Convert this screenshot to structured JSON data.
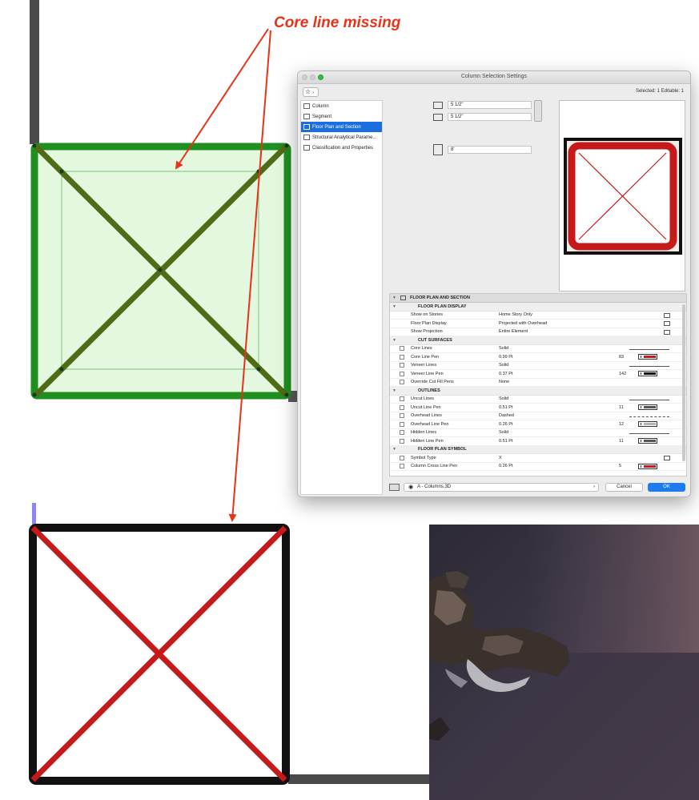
{
  "annotation": {
    "text": "Core line missing"
  },
  "dialog": {
    "title": "Column Selection Settings",
    "selected_info": "Selected: 1 Editable: 1",
    "favorites_label": "☆",
    "side_items": [
      {
        "label": "Column",
        "active": false
      },
      {
        "label": "Segment",
        "active": false
      },
      {
        "label": "Floor Plan and Section",
        "active": true
      },
      {
        "label": "Structural Analytical Parame...",
        "active": false
      },
      {
        "label": "Classification and Properties",
        "active": false
      }
    ],
    "width_value": "5 1/2\"",
    "depth_value": "5 1/2\"",
    "height_value": "8'",
    "panel_title": "FLOOR PLAN AND SECTION",
    "groups": [
      {
        "label": "FLOOR PLAN DISPLAY",
        "rows": [
          {
            "name": "Show on Stories",
            "value": "Home Story Only",
            "num": "",
            "swatch": "",
            "line": "",
            "icon": "stories-icon"
          },
          {
            "name": "Floor Plan Display",
            "value": "Projected with Overhead",
            "num": "",
            "swatch": "",
            "line": "",
            "icon": "display-icon"
          },
          {
            "name": "Show Projection",
            "value": "Entire Element",
            "num": "",
            "swatch": "",
            "line": "",
            "icon": "projection-icon"
          }
        ]
      },
      {
        "label": "CUT SURFACES",
        "rows": [
          {
            "name": "Core Lines",
            "value": "Solid",
            "num": "",
            "swatch": "",
            "line": "solid"
          },
          {
            "name": "Core Line Pen",
            "value": "0.99 Pt",
            "num": "83",
            "swatch": "#c51a1a",
            "line": ""
          },
          {
            "name": "Veneer Lines",
            "value": "Solid",
            "num": "",
            "swatch": "",
            "line": "solid"
          },
          {
            "name": "Veneer Line Pen",
            "value": "0.37 Pt",
            "num": "142",
            "swatch": "#111111",
            "line": ""
          },
          {
            "name": "Override Cut Fill Pens",
            "value": "None",
            "num": "",
            "swatch": "",
            "line": ""
          }
        ]
      },
      {
        "label": "OUTLINES",
        "rows": [
          {
            "name": "Uncut Lines",
            "value": "Solid",
            "num": "",
            "swatch": "",
            "line": "solid"
          },
          {
            "name": "Uncut Line Pen",
            "value": "0.51 Pt",
            "num": "11",
            "swatch": "#555555",
            "line": ""
          },
          {
            "name": "Overhead Lines",
            "value": "Dashed",
            "num": "",
            "swatch": "",
            "line": "dashed"
          },
          {
            "name": "Overhead Line Pen",
            "value": "0.26 Pt",
            "num": "12",
            "swatch": "#9a9a9a",
            "line": ""
          },
          {
            "name": "Hidden Lines",
            "value": "Solid",
            "num": "",
            "swatch": "",
            "line": "solid"
          },
          {
            "name": "Hidden Line Pen",
            "value": "0.51 Pt",
            "num": "11",
            "swatch": "#555555",
            "line": ""
          }
        ]
      },
      {
        "label": "FLOOR PLAN SYMBOL",
        "rows": [
          {
            "name": "Symbol Type",
            "value": "X",
            "num": "",
            "swatch": "",
            "line": "",
            "icon": "symbol-icon"
          },
          {
            "name": "Column Cross Line Pen",
            "value": "0.26 Pt",
            "num": "5",
            "swatch": "#c51a1a",
            "line": ""
          }
        ]
      }
    ],
    "layer_value": "A - Columns.3D",
    "cancel_label": "Cancel",
    "ok_label": "OK"
  },
  "colors": {
    "annotation_red": "#e8321a",
    "column_green": "#1f8f1f",
    "cross_olive": "#4f6b16",
    "fill_green": "#e4f7df",
    "cross_red": "#c51a1a",
    "ok_blue": "#1d7af0",
    "selection_blue": "#1b6ee0"
  }
}
